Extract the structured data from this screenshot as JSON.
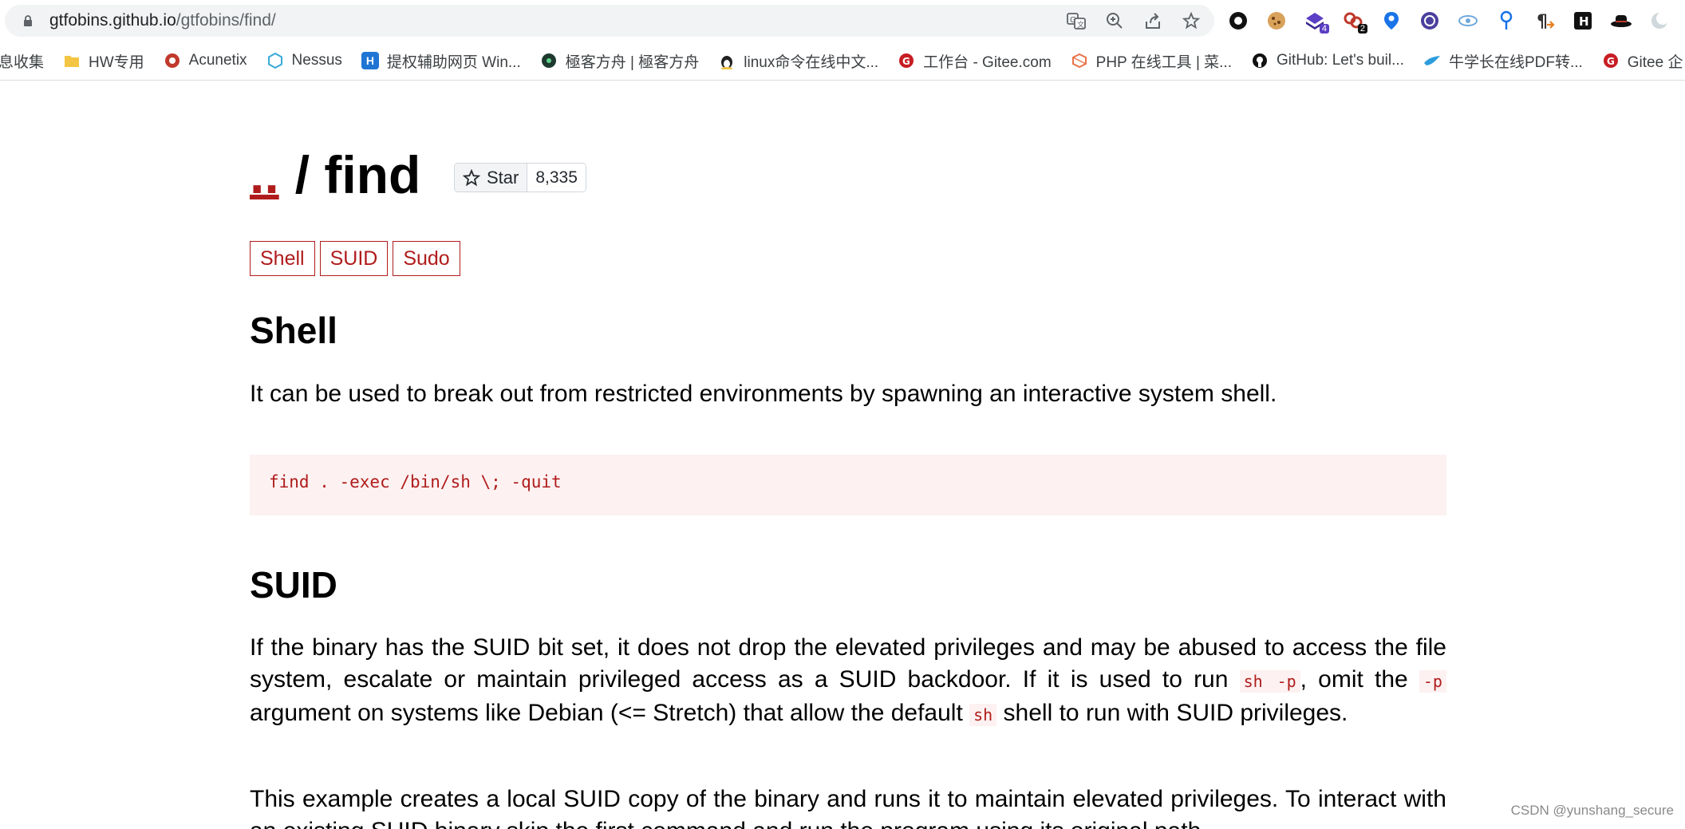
{
  "browser": {
    "url_host": "gtfobins.github.io",
    "url_path": "/gtfobins/find/",
    "omnibox_icons": [
      "translate-icon",
      "zoom-icon",
      "share-icon",
      "bookmark-star-icon"
    ],
    "extension_badges": {
      "ext3": "4",
      "ext4": "2"
    }
  },
  "bookmarks": [
    {
      "label": "息收集",
      "icon": "folder-icon"
    },
    {
      "label": "HW专用",
      "icon": "folder-icon"
    },
    {
      "label": "Acunetix",
      "icon": "acunetix-icon"
    },
    {
      "label": "Nessus",
      "icon": "nessus-icon"
    },
    {
      "label": "提权辅助网页 Win...",
      "icon": "h-icon"
    },
    {
      "label": "極客方舟 | 極客方舟",
      "icon": "geek-icon"
    },
    {
      "label": "linux命令在线中文...",
      "icon": "linux-icon"
    },
    {
      "label": "工作台 - Gitee.com",
      "icon": "gitee-icon"
    },
    {
      "label": "PHP 在线工具 | 菜...",
      "icon": "php-icon"
    },
    {
      "label": "GitHub: Let's buil...",
      "icon": "github-icon"
    },
    {
      "label": "牛学长在线PDF转...",
      "icon": "bird-icon"
    },
    {
      "label": "Gitee 企",
      "icon": "gitee-icon"
    }
  ],
  "page": {
    "breadcrumb": "..",
    "title": "/ find",
    "star_label": "Star",
    "star_count": "8,335",
    "tags": [
      "Shell",
      "SUID",
      "Sudo"
    ],
    "shell": {
      "heading": "Shell",
      "description": "It can be used to break out from restricted environments by spawning an interactive system shell.",
      "code": "find . -exec /bin/sh \\; -quit"
    },
    "suid": {
      "heading": "SUID",
      "p1_a": "If the binary has the SUID bit set, it does not drop the elevated privileges and may be abused to access the file system, escalate or maintain privileged access as a SUID backdoor. If it is used to run ",
      "p1_code1": "sh -p",
      "p1_b": ", omit the ",
      "p1_code2": "-p",
      "p1_c": " argument on systems like Debian (<= Stretch) that allow the default ",
      "p1_code3": "sh",
      "p1_d": " shell to run with SUID privileges.",
      "p2": "This example creates a local SUID copy of the binary and runs it to maintain elevated privileges. To interact with an existing SUID binary skip the first command and run the program using its original path."
    }
  },
  "watermark": "CSDN @yunshang_secure"
}
